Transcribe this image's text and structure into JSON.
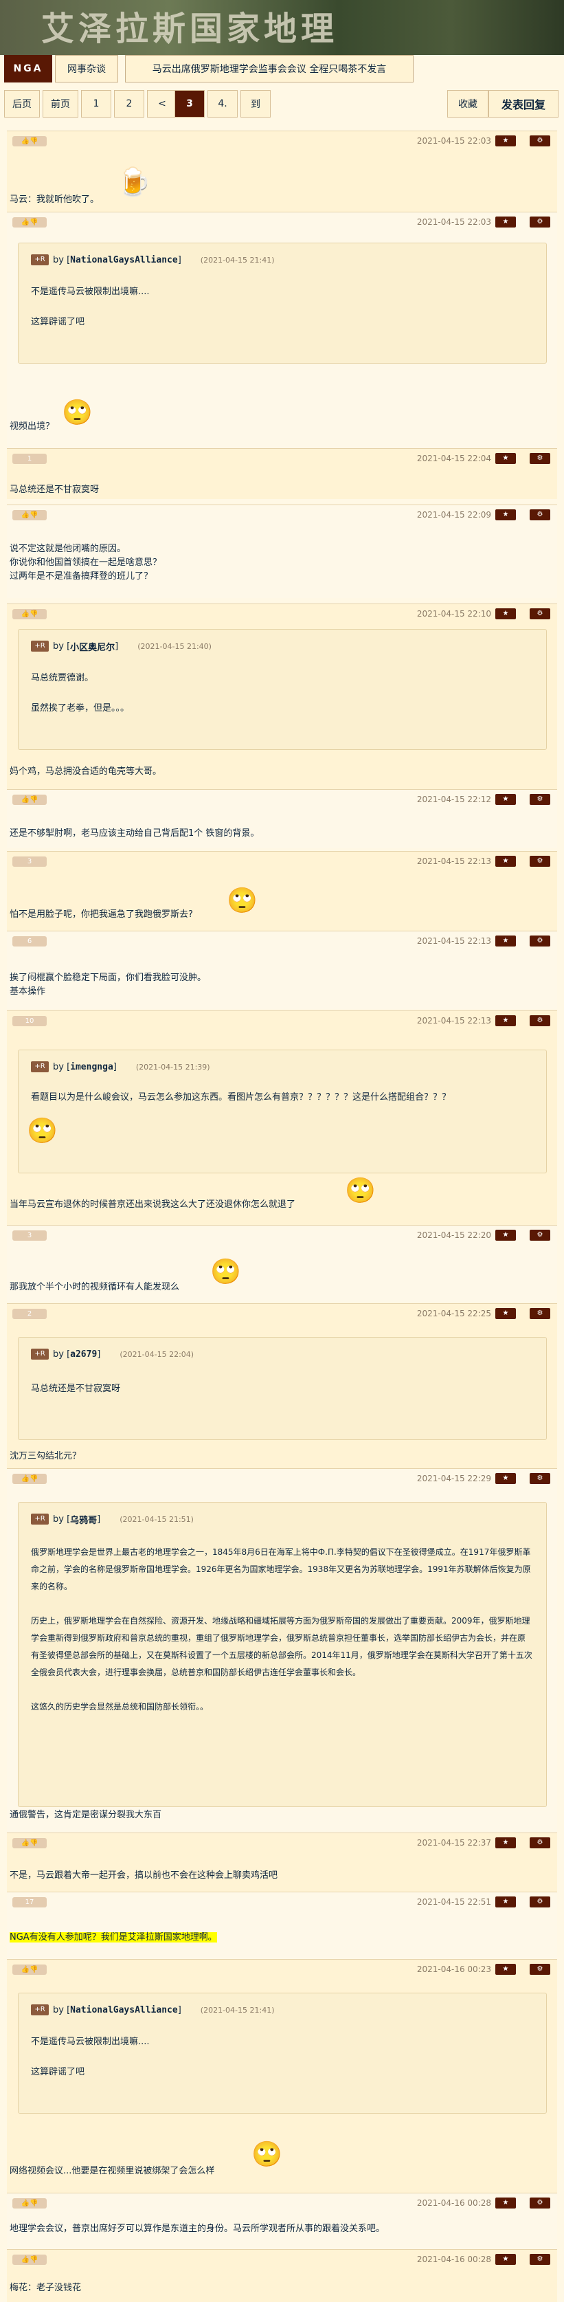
{
  "site": {
    "banner_title": "艾泽拉斯国家地理",
    "logo": "NGA",
    "forum": "网事杂谈",
    "thread_title": "马云出席俄罗斯地理学会监事会会议 全程只喝茶不发言"
  },
  "pager": {
    "back": "后页",
    "prev": "前页",
    "pages": [
      "1",
      "2",
      "<",
      "3",
      "4.",
      "到"
    ],
    "fav": "收藏",
    "reply": "发表回复"
  },
  "posts": [
    {
      "time": "2021-04-15 22:03",
      "text": "马云：我就听他吹了。"
    },
    {
      "time": "2021-04-15 22:03",
      "quote_user": "NationalGaysAlliance",
      "quote_time": "(2021-04-15 21:41)",
      "quote_text": "不是遥传马云被限制出境嘛....\n\n这算辟谣了吧",
      "text": "视频出境？"
    },
    {
      "time": "2021-04-15 22:04",
      "likes": "1",
      "text": "马总统还是不甘寂寞呀"
    },
    {
      "time": "2021-04-15 22:09",
      "text": "说不定这就是他闭嘴的原因。\n你说你和他国首领搞在一起是啥意思？\n过两年是不是准备搞拜登的班儿了？"
    },
    {
      "time": "2021-04-15 22:10",
      "quote_user": "小区奥尼尔",
      "quote_time": "(2021-04-15 21:40)",
      "quote_text": "马总统贾德谢。\n\n虽然挨了老拳，但是。。。",
      "text": "妈个鸡，马总拥没合适的龟壳等大哥。"
    },
    {
      "time": "2021-04-15 22:12",
      "text": "还是不够掣肘啊，老马应该主动给自己背后配1个 铁窗的背景。"
    },
    {
      "time": "2021-04-15 22:13",
      "likes": "3",
      "text": "怕不是用脸子呢，你把我逼急了我跑俄罗斯去?"
    },
    {
      "time": "2021-04-15 22:13",
      "likes": "6",
      "text": "挨了闷棍赢个脸稳定下局面，你们看我脸可没肿。\n基本操作"
    },
    {
      "time": "2021-04-15 22:13",
      "likes": "10",
      "quote_user": "imengnga",
      "quote_time": "(2021-04-15 21:39)",
      "quote_text": "看题目以为是什么峻会议，马云怎么参加这东西。看图片怎么有普京？？？？？？这是什么搭配组合？？？",
      "text": "当年马云宣布退休的时候普京还出来说我这么大了还没退休你怎么就退了"
    },
    {
      "time": "2021-04-15 22:20",
      "likes": "3",
      "text": "那我放个半个小时的视频循环有人能发现么"
    },
    {
      "time": "2021-04-15 22:25",
      "likes": "2",
      "quote_user": "a2679",
      "quote_time": "(2021-04-15 22:04)",
      "quote_text": "马总统还是不甘寂寞呀",
      "text": "沈万三勾结北元？"
    },
    {
      "time": "2021-04-15 22:29",
      "quote_user": "乌鸦哥",
      "quote_time": "(2021-04-15 21:51)",
      "quote_text": "俄罗斯地理学会是世界上最古老的地理学会之一，1845年8月6日在海军上将中Ф.П.李特契的倡议下在圣彼得堡成立。在1917年俄罗斯革命之前，学会的名称是俄罗斯帝国地理学会。1926年更名为国家地理学会。1938年又更名为苏联地理学会。1991年苏联解体后恢复为原来的名称。\n\n历史上，俄罗斯地理学会在自然探险、资源开发、地缘战略和疆域拓展等方面为俄罗斯帝国的发展做出了重要贡献。2009年，俄罗斯地理学会重新得到俄罗斯政府和普京总统的重视，重组了俄罗斯地理学会，俄罗斯总统普京担任董事长，选举国防部长绍伊古为会长，并在原有圣彼得堡总部会所的基础上，又在莫斯科设置了一个五层楼的新总部会所。2014年11月，俄罗斯地理学会在莫斯科大学召开了第十五次全俄会员代表大会，进行理事会换届，总统普京和国防部长绍伊古连任学会董事长和会长。\n\n这悠久的历史学会显然是总统和国防部长领衔。。",
      "text": "通俄警告，这肯定是密谋分裂我大东百"
    },
    {
      "time": "2021-04-15 22:37",
      "text": "不是，马云跟着大帝一起开会，搞以前也不会在这种会上聊卖鸡活吧"
    },
    {
      "time": "2021-04-15 22:51",
      "likes": "17",
      "text": "NGA有没有人参加呢？我们是艾泽拉斯国家地理啊。"
    },
    {
      "time": "2021-04-16 00:23",
      "quote_user": "NationalGaysAlliance",
      "quote_time": "(2021-04-15 21:41)",
      "quote_text": "不是遥传马云被限制出境嘛....\n\n这算辟谣了吧",
      "text": "网络视频会议...他要是在视频里说被绑架了会怎么样"
    },
    {
      "time": "2021-04-16 00:28",
      "text": "地理学会会议，普京出席好歹可以算作是东道主的身份。马云所学观者所从事的跟着没关系吧。"
    },
    {
      "time": "2021-04-16 00:28",
      "text": "梅花：老子没钱花"
    }
  ]
}
